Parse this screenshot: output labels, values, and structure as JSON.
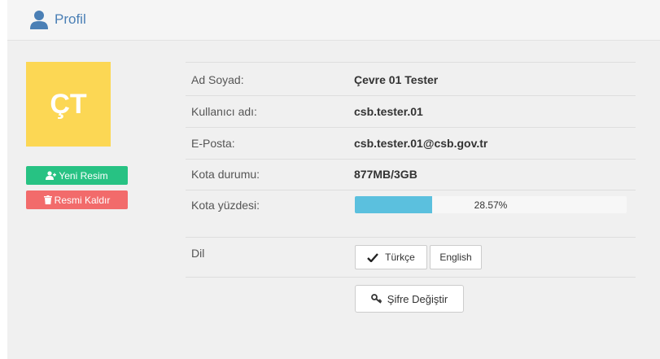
{
  "header": {
    "title": "Profil",
    "icon": "user-icon"
  },
  "avatar": {
    "initials": "ÇT",
    "color": "#fcd754"
  },
  "photo_buttons": {
    "new": {
      "label": "Yeni Resim",
      "icon": "user-plus-icon",
      "color": "#27c283"
    },
    "remove": {
      "label": "Resmi Kaldır",
      "icon": "trash-icon",
      "color": "#f26b6b"
    }
  },
  "profile": {
    "fullname": {
      "label": "Ad Soyad:",
      "value": "Çevre 01 Tester"
    },
    "username": {
      "label": "Kullanıcı adı:",
      "value": "csb.tester.01"
    },
    "email": {
      "label": "E-Posta:",
      "value": "csb.tester.01@csb.gov.tr"
    },
    "quota": {
      "label": "Kota durumu:",
      "value": "877MB/3GB"
    },
    "quota_percent": {
      "label": "Kota yüzdesi:",
      "text": "28.57%",
      "fraction": 0.2857
    }
  },
  "language": {
    "label": "Dil",
    "options": [
      {
        "label": "Türkçe",
        "selected": true
      },
      {
        "label": "English",
        "selected": false
      }
    ]
  },
  "password": {
    "label": "Şifre Değiştir",
    "icon": "key-icon"
  }
}
